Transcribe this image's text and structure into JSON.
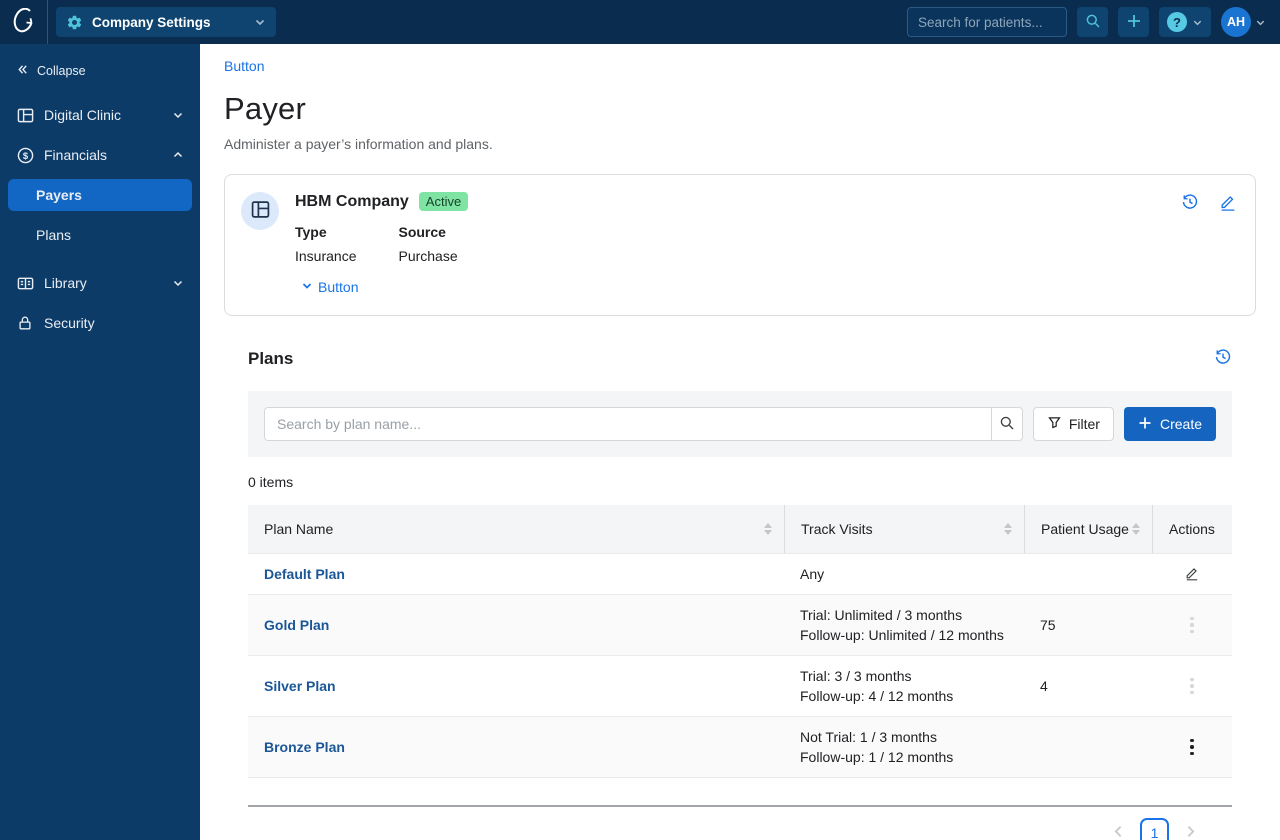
{
  "topbar": {
    "company_settings_label": "Company Settings",
    "search_placeholder": "Search for patients...",
    "help_label": "?",
    "avatar_initials": "AH"
  },
  "sidebar": {
    "collapse_label": "Collapse",
    "items": [
      {
        "label": "Digital Clinic"
      },
      {
        "label": "Financials"
      },
      {
        "label": "Payers",
        "active": true
      },
      {
        "label": "Plans"
      },
      {
        "label": "Library"
      },
      {
        "label": "Security"
      }
    ]
  },
  "page": {
    "breadcrumb_button_label": "Button",
    "title": "Payer",
    "subtitle": "Administer a payer’s information and plans."
  },
  "payer_card": {
    "name": "HBM Company",
    "status": "Active",
    "type_label": "Type",
    "type_value": "Insurance",
    "source_label": "Source",
    "source_value": "Purchase",
    "expand_button_label": "Button"
  },
  "plans": {
    "heading": "Plans",
    "search_placeholder": "Search by plan name...",
    "filter_label": "Filter",
    "create_label": "Create",
    "items_count": "0 items",
    "table": {
      "columns": [
        "Plan Name",
        "Track Visits",
        "Patient Usage",
        "Actions"
      ],
      "rows": [
        {
          "name": "Default Plan",
          "track_visits": [
            "Any"
          ],
          "patient_usage": ""
        },
        {
          "name": "Gold Plan",
          "track_visits": [
            "Trial: Unlimited / 3 months",
            "Follow-up: Unlimited / 12 months"
          ],
          "patient_usage": "75"
        },
        {
          "name": "Silver Plan",
          "track_visits": [
            "Trial: 3 / 3 months",
            "Follow-up: 4 / 12 months"
          ],
          "patient_usage": "4"
        },
        {
          "name": "Bronze Plan",
          "track_visits": [
            "Not Trial: 1 / 3 months",
            "Follow-up: 1 / 12 months"
          ],
          "patient_usage": ""
        }
      ]
    },
    "pagination": {
      "current_page": "1"
    }
  },
  "colors": {
    "topbar_bg": "#0a2c4e",
    "sidebar_bg": "#0d3b68",
    "active_nav_bg": "#1266c4",
    "accent_teal": "#4ec3da",
    "link_blue": "#1a73e8",
    "plan_link_blue": "#1b5796",
    "create_button_bg": "#1565c0",
    "active_badge_bg": "#7fe3a4",
    "active_badge_text": "#17432a",
    "avatar_bg": "#1a74d2"
  }
}
